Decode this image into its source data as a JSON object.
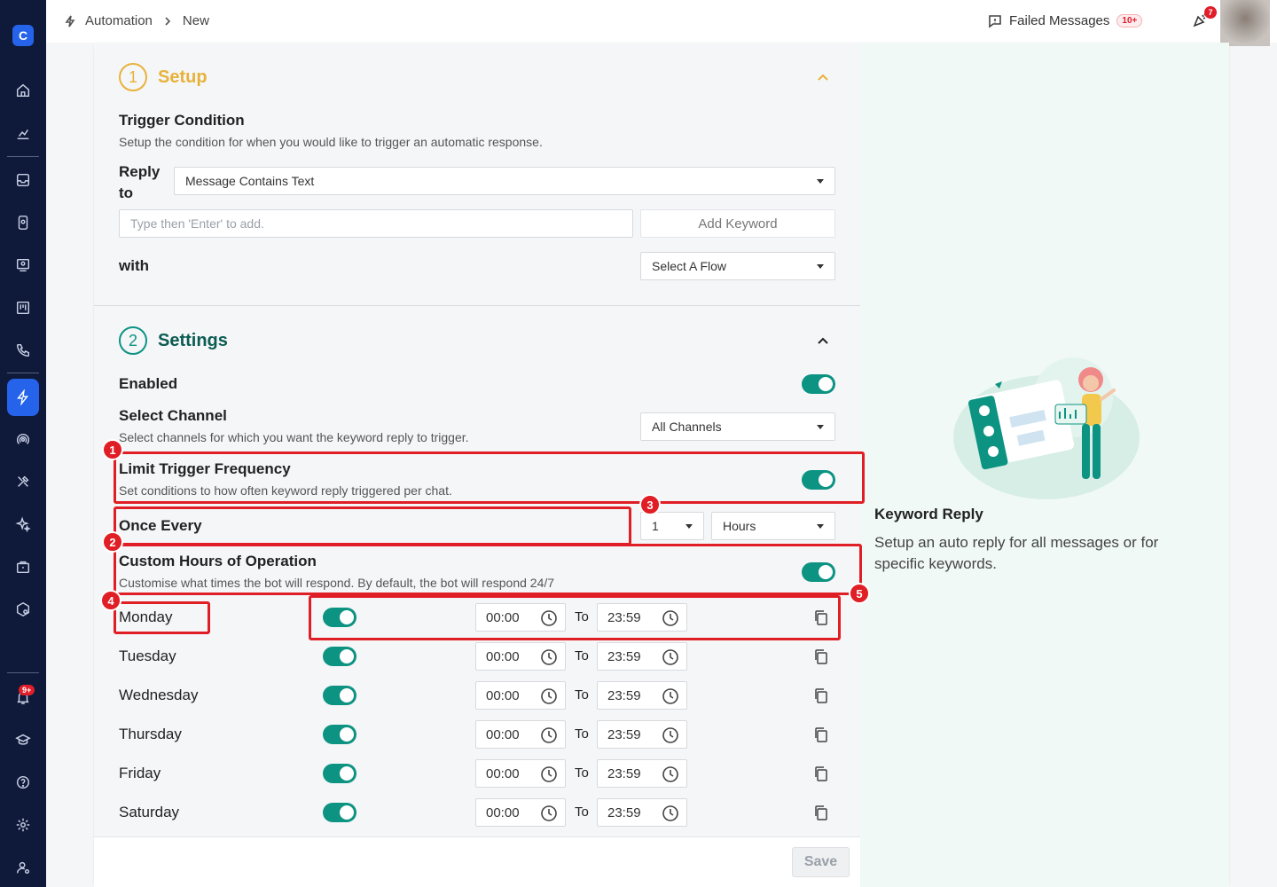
{
  "breadcrumb": {
    "root": "Automation",
    "current": "New"
  },
  "header": {
    "failed_messages": "Failed Messages",
    "failed_badge": "10+",
    "notif_badge": "7"
  },
  "sidebar": {
    "notif_badge": "9+"
  },
  "setup": {
    "step": "1",
    "title": "Setup",
    "trigger_title": "Trigger Condition",
    "trigger_desc": "Setup the condition for when you would like to trigger an automatic response.",
    "reply_to_label": "Reply to",
    "reply_to_value": "Message Contains Text",
    "keyword_placeholder": "Type then 'Enter' to add.",
    "add_keyword": "Add Keyword",
    "with_label": "with",
    "flow_value": "Select A Flow"
  },
  "settings": {
    "step": "2",
    "title": "Settings",
    "enabled": "Enabled",
    "channel_title": "Select Channel",
    "channel_desc": "Select channels for which you want the keyword reply to trigger.",
    "channel_value": "All Channels",
    "limit_title": "Limit Trigger Frequency",
    "limit_desc": "Set conditions to how often keyword reply triggered per chat.",
    "once_every": "Once Every",
    "freq_value": "1",
    "freq_unit": "Hours",
    "custom_title": "Custom Hours of Operation",
    "custom_desc": "Customise what times the bot will respond. By default, the bot will respond 24/7",
    "to_label": "To",
    "days": [
      {
        "name": "Monday",
        "from": "00:00",
        "to": "23:59"
      },
      {
        "name": "Tuesday",
        "from": "00:00",
        "to": "23:59"
      },
      {
        "name": "Wednesday",
        "from": "00:00",
        "to": "23:59"
      },
      {
        "name": "Thursday",
        "from": "00:00",
        "to": "23:59"
      },
      {
        "name": "Friday",
        "from": "00:00",
        "to": "23:59"
      },
      {
        "name": "Saturday",
        "from": "00:00",
        "to": "23:59"
      }
    ]
  },
  "annotations": [
    "1",
    "2",
    "3",
    "4",
    "5"
  ],
  "footer": {
    "save": "Save"
  },
  "info": {
    "title": "Keyword Reply",
    "desc": "Setup an auto reply for all messages or for specific keywords."
  },
  "colors": {
    "accent": "#0d9382",
    "setup": "#e8b23a",
    "annotation": "#e01e25",
    "sidebar": "#0f1a3a"
  }
}
